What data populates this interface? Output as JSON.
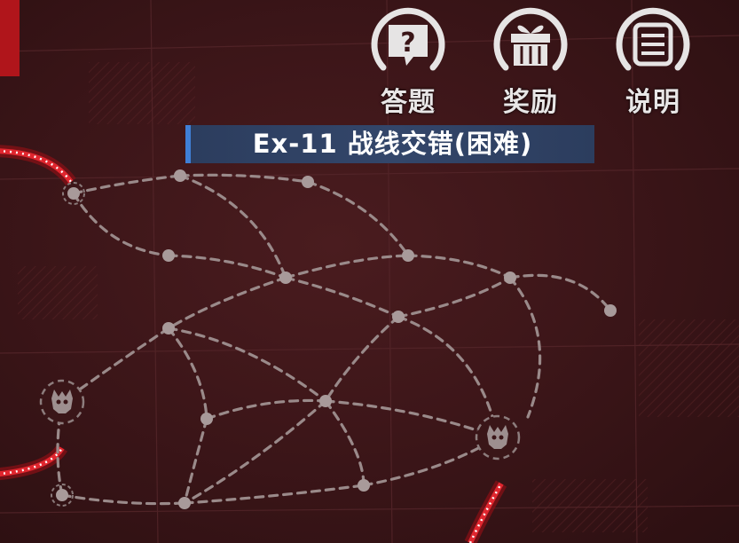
{
  "colors": {
    "background": "#3d1619",
    "path_dash": "#9a8a8a",
    "node": "#a89a9a",
    "accent_red": "#d8232a",
    "title_bar": "#2f4166",
    "title_accent": "#3f7fd6",
    "button_icon": "#e6e4e4"
  },
  "top_buttons": [
    {
      "label": "答题",
      "icon": "question-bubble-icon"
    },
    {
      "label": "奖励",
      "icon": "gift-box-icon"
    },
    {
      "label": "说明",
      "icon": "list-document-icon"
    }
  ],
  "stage": {
    "title": "Ex-11  战线交错(困难)"
  },
  "map": {
    "node_count": 17,
    "enemy_node_count": 2
  }
}
